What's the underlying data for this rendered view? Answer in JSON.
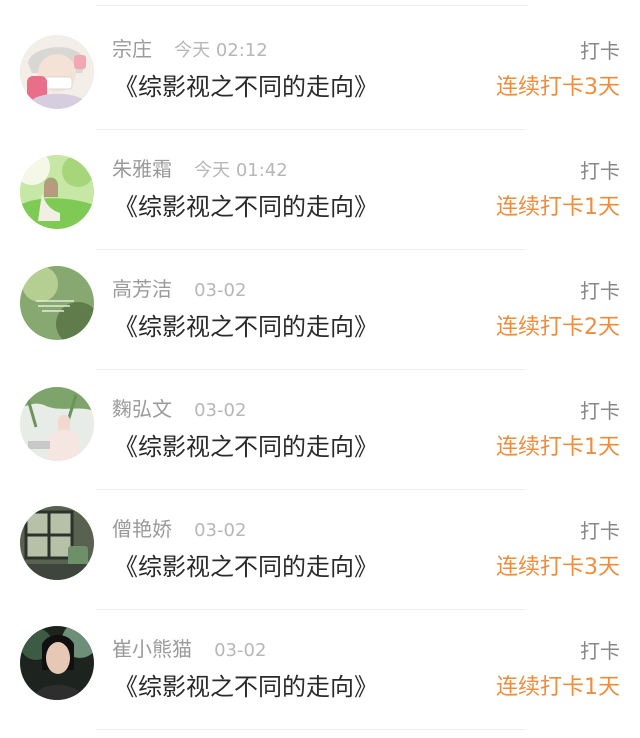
{
  "entries": [
    {
      "name": "宗庄",
      "time": "今天 02:12",
      "book": "《综影视之不同的走向》",
      "action": "打卡",
      "streak": "连续打卡3天",
      "avatar_icon": "anime-boy-mask-avatar"
    },
    {
      "name": "朱雅霜",
      "time": "今天 01:42",
      "book": "《综影视之不同的走向》",
      "action": "打卡",
      "streak": "连续打卡1天",
      "avatar_icon": "girl-green-background-avatar"
    },
    {
      "name": "高芳洁",
      "time": "03-02",
      "book": "《综影视之不同的走向》",
      "action": "打卡",
      "streak": "连续打卡2天",
      "avatar_icon": "green-text-avatar"
    },
    {
      "name": "麴弘文",
      "time": "03-02",
      "book": "《综影视之不同的走向》",
      "action": "打卡",
      "streak": "连续打卡1天",
      "avatar_icon": "ivy-wall-avatar"
    },
    {
      "name": "僧艳娇",
      "time": "03-02",
      "book": "《综影视之不同的走向》",
      "action": "打卡",
      "streak": "连续打卡3天",
      "avatar_icon": "window-plant-avatar"
    },
    {
      "name": "崔小熊猫",
      "time": "03-02",
      "book": "《综影视之不同的走向》",
      "action": "打卡",
      "streak": "连续打卡1天",
      "avatar_icon": "dark-haired-man-avatar"
    }
  ],
  "colors": {
    "accent_orange": "#f08c3c",
    "name_gray": "#9a9a9a",
    "book_text": "#2a2a2a",
    "divider": "#ececec"
  }
}
